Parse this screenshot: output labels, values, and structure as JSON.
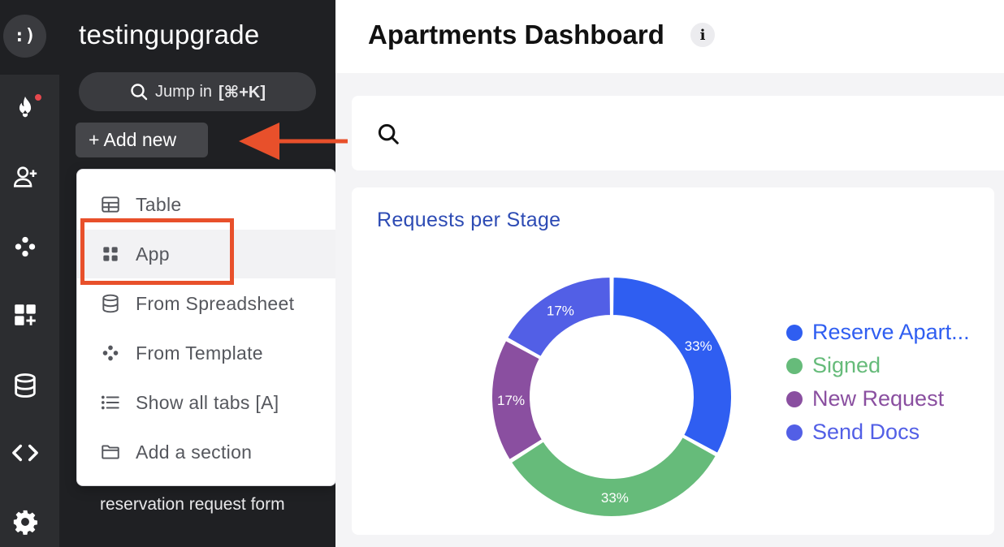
{
  "rail": {
    "logo_text": ":)",
    "icons": [
      "fire-icon",
      "add-user-icon",
      "template-icon",
      "add-app-icon",
      "database-icon",
      "code-icon",
      "gear-icon"
    ]
  },
  "sidebar": {
    "workspace_name": "testingupgrade",
    "jump_label": "Jump in",
    "jump_shortcut": "[⌘+K]",
    "add_new_label": "+ Add new",
    "form_link": "reservation request form"
  },
  "menu": {
    "items": [
      {
        "label": "Table",
        "icon": "table-icon"
      },
      {
        "label": "App",
        "icon": "app-grid-icon"
      },
      {
        "label": "From Spreadsheet",
        "icon": "database-icon"
      },
      {
        "label": "From Template",
        "icon": "template-icon"
      },
      {
        "label": "Show all tabs [A]",
        "icon": "list-icon"
      },
      {
        "label": "Add a section",
        "icon": "folder-icon"
      }
    ]
  },
  "main": {
    "title": "Apartments Dashboard",
    "info_icon": "i"
  },
  "colors": {
    "accent": "#e8502b",
    "blue": "#2f5ef1",
    "green": "#66bb7a",
    "purple": "#8a4fa0",
    "indigo": "#525fe6"
  },
  "chart_data": {
    "type": "pie",
    "title": "Requests per Stage",
    "legend_position": "right",
    "categories": [
      "Reserve Apart...",
      "Signed",
      "New Request",
      "Send Docs"
    ],
    "values": [
      33,
      33,
      17,
      17
    ],
    "labels": [
      "33%",
      "33%",
      "17%",
      "17%"
    ],
    "colors": [
      "#2f5ef1",
      "#66bb7a",
      "#8a4fa0",
      "#525fe6"
    ]
  }
}
